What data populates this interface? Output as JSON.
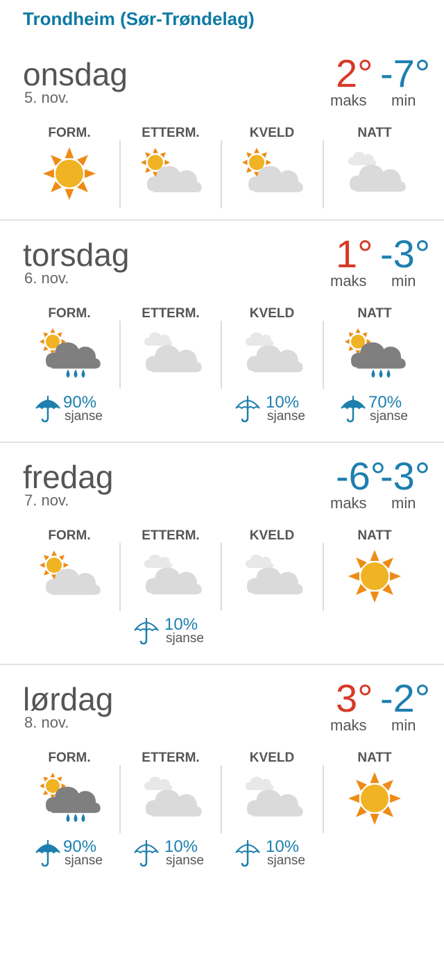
{
  "location": "Trondheim (Sør-Trøndelag)",
  "colors": {
    "warm": "#d63a28",
    "cold": "#1d7fae",
    "sun": "#f0b323",
    "sun_rays": "#ee8b16",
    "cloud_light": "#dadada",
    "cloud_dark": "#7f7f7f"
  },
  "labels": {
    "max": "maks",
    "min": "min",
    "chance": "sjanse"
  },
  "periods": [
    "FORM.",
    "ETTERM.",
    "KVELD",
    "NATT"
  ],
  "days": [
    {
      "name": "onsdag",
      "date": "5. nov.",
      "max": "2°",
      "min": "-7°",
      "max_tone": "warm",
      "min_tone": "cold",
      "forecast": [
        {
          "icon": "sun-icon",
          "precip": null
        },
        {
          "icon": "partly-cloudy-icon",
          "precip": null
        },
        {
          "icon": "partly-cloudy-icon",
          "precip": null
        },
        {
          "icon": "cloud-icon",
          "precip": null
        }
      ]
    },
    {
      "name": "torsdag",
      "date": "6. nov.",
      "max": "1°",
      "min": "-3°",
      "max_tone": "warm",
      "min_tone": "cold",
      "forecast": [
        {
          "icon": "sun-rain-icon",
          "precip": "90%"
        },
        {
          "icon": "cloud-icon",
          "precip": null
        },
        {
          "icon": "cloud-icon",
          "precip": "10%"
        },
        {
          "icon": "sun-rain-icon",
          "precip": "70%"
        }
      ]
    },
    {
      "name": "fredag",
      "date": "7. nov.",
      "max": "-6°",
      "min": "-3°",
      "max_tone": "cold",
      "min_tone": "cold",
      "forecast": [
        {
          "icon": "partly-cloudy-icon",
          "precip": null
        },
        {
          "icon": "cloud-icon",
          "precip": "10%"
        },
        {
          "icon": "cloud-icon",
          "precip": null
        },
        {
          "icon": "sun-icon",
          "precip": null
        }
      ]
    },
    {
      "name": "lørdag",
      "date": "8. nov.",
      "max": "3°",
      "min": "-2°",
      "max_tone": "warm",
      "min_tone": "cold",
      "forecast": [
        {
          "icon": "sun-rain-icon",
          "precip": "90%"
        },
        {
          "icon": "cloud-icon",
          "precip": "10%"
        },
        {
          "icon": "cloud-icon",
          "precip": "10%"
        },
        {
          "icon": "sun-icon",
          "precip": null
        }
      ]
    }
  ]
}
